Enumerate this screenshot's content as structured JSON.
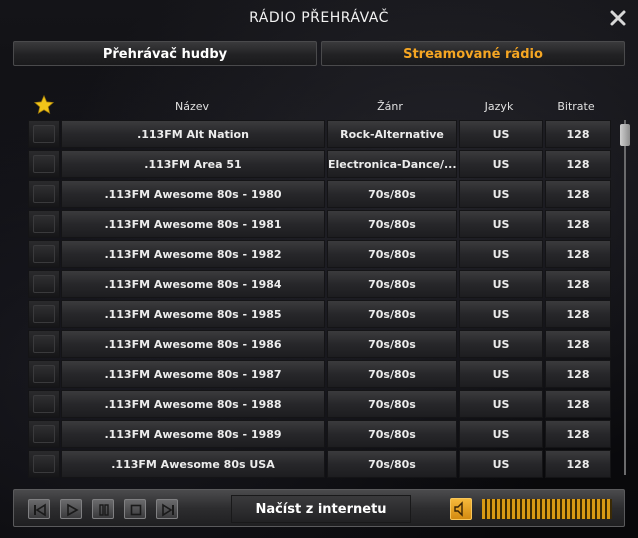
{
  "window": {
    "title": "RÁDIO PŘEHRÁVAČ"
  },
  "tabs": [
    {
      "label": "Přehrávač hudby",
      "active": false
    },
    {
      "label": "Streamované rádio",
      "active": true
    }
  ],
  "table": {
    "headers": {
      "name": "Název",
      "genre": "Žánr",
      "language": "Jazyk",
      "bitrate": "Bitrate"
    },
    "rows": [
      {
        "name": ".113FM Alt Nation",
        "genre": "Rock-Alternative",
        "language": "US",
        "bitrate": "128"
      },
      {
        "name": ".113FM Area 51",
        "genre": "Electronica-Dance/...",
        "language": "US",
        "bitrate": "128"
      },
      {
        "name": ".113FM Awesome 80s - 1980",
        "genre": "70s/80s",
        "language": "US",
        "bitrate": "128"
      },
      {
        "name": ".113FM Awesome 80s - 1981",
        "genre": "70s/80s",
        "language": "US",
        "bitrate": "128"
      },
      {
        "name": ".113FM Awesome 80s - 1982",
        "genre": "70s/80s",
        "language": "US",
        "bitrate": "128"
      },
      {
        "name": ".113FM Awesome 80s - 1984",
        "genre": "70s/80s",
        "language": "US",
        "bitrate": "128"
      },
      {
        "name": ".113FM Awesome 80s - 1985",
        "genre": "70s/80s",
        "language": "US",
        "bitrate": "128"
      },
      {
        "name": ".113FM Awesome 80s - 1986",
        "genre": "70s/80s",
        "language": "US",
        "bitrate": "128"
      },
      {
        "name": ".113FM Awesome 80s - 1987",
        "genre": "70s/80s",
        "language": "US",
        "bitrate": "128"
      },
      {
        "name": ".113FM Awesome 80s - 1988",
        "genre": "70s/80s",
        "language": "US",
        "bitrate": "128"
      },
      {
        "name": ".113FM Awesome 80s - 1989",
        "genre": "70s/80s",
        "language": "US",
        "bitrate": "128"
      },
      {
        "name": ".113FM Awesome 80s USA",
        "genre": "70s/80s",
        "language": "US",
        "bitrate": "128"
      }
    ]
  },
  "controls": {
    "load_label": "Načíst z internetu",
    "volume_level": 1.0
  },
  "icons": {
    "close": "close-icon",
    "favorite": "star-icon",
    "prev": "skip-back-icon",
    "play": "play-icon",
    "pause": "pause-icon",
    "stop": "stop-icon",
    "next": "skip-forward-icon",
    "speaker": "speaker-icon"
  },
  "colors": {
    "accent": "#f5a623",
    "star": "#f0c419"
  }
}
